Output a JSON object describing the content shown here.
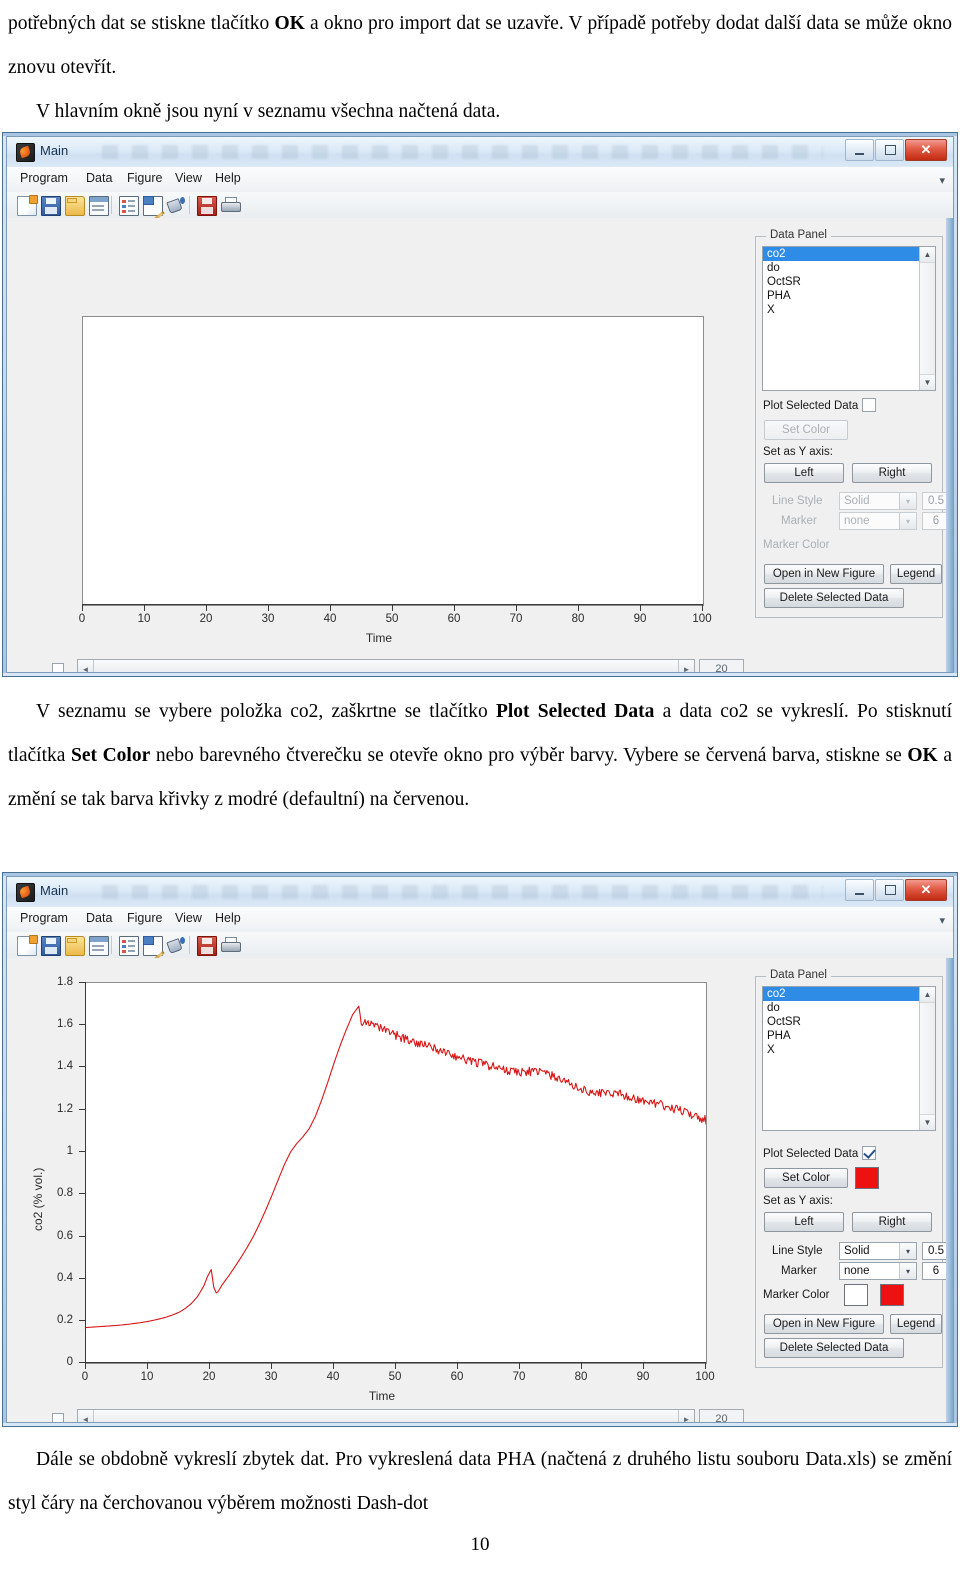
{
  "document": {
    "paragraph_top": [
      "potřebných dat se stiskne tlačítko <b>OK</b> a okno pro import dat se uzavře. V případě potřeby dodat další data se může okno znovu otevřít.",
      "V hlavním okně jsou nyní v seznamu všechna načtená data."
    ],
    "paragraph_mid": "V seznamu se vybere položka co2, zaškrtne se tlačítko <b>Plot Selected Data</b> a data co2 se vykreslí. Po stisknutí tlačítka <b>Set Color</b> nebo barevného čtverečku se otevře okno pro výběr barvy. Vybere se červená barva, stiskne se <b>OK</b> a změní se tak barva křivky z modré (defaultní) na červenou.",
    "paragraph_bottom": "Dále se obdobně vykreslí zbytek dat. Pro vykreslená data PHA (načtená z druhého listu souboru Data.xls) se změní styl čáry na čerchovanou výběrem možnosti Dash-dot",
    "page_number": "10"
  },
  "window1": {
    "title": "Main",
    "icon": "matlab-icon",
    "window_buttons": {
      "minimize": "minimize-icon",
      "maximize": "maximize-icon",
      "close": "✕"
    },
    "menus": [
      "Program",
      "Data",
      "Figure",
      "View",
      "Help"
    ],
    "menu_overflow": "▾",
    "toolbar_icons": [
      "new-file-icon",
      "save-icon",
      "open-folder-icon",
      "window-icon",
      "table-icon",
      "edit-icon",
      "paint-bucket-icon",
      "save-figure-icon",
      "print-icon"
    ],
    "data_panel": {
      "title": "Data Panel",
      "items": [
        "co2",
        "do",
        "OctSR",
        "PHA",
        "X"
      ],
      "selected": "co2",
      "scroll_up": "▲",
      "scroll_down": "▼"
    },
    "controls": {
      "plot_selected_data_label": "Plot Selected Data",
      "plot_selected_data_checked": false,
      "set_color_label": "Set Color",
      "set_color_enabled": false,
      "set_color_swatch": null,
      "set_y_axis_label": "Set as Y axis:",
      "left_label": "Left",
      "right_label": "Right",
      "line_style_label": "Line Style",
      "line_style_value": "Solid",
      "line_width_value": "0.5",
      "marker_label": "Marker",
      "marker_value": "none",
      "marker_size_value": "6",
      "marker_color_label": "Marker Color",
      "marker_color_enabled": false,
      "marker_face_swatch": null,
      "marker_edge_swatch": null,
      "open_in_new_figure_label": "Open in New Figure",
      "legend_label": "Legend",
      "delete_selected_data_label": "Delete Selected Data",
      "fields_enabled": false,
      "dropdown_arrow": "▾"
    },
    "status": {
      "checkbox_checked": false,
      "scroll_left_arrow": "◄",
      "scroll_right_arrow": "►",
      "value": "20"
    }
  },
  "window2": {
    "title": "Main",
    "icon": "matlab-icon",
    "window_buttons": {
      "minimize": "minimize-icon",
      "maximize": "maximize-icon",
      "close": "✕"
    },
    "menus": [
      "Program",
      "Data",
      "Figure",
      "View",
      "Help"
    ],
    "menu_overflow": "▾",
    "toolbar_icons": [
      "new-file-icon",
      "save-icon",
      "open-folder-icon",
      "window-icon",
      "table-icon",
      "edit-icon",
      "paint-bucket-icon",
      "save-figure-icon",
      "print-icon"
    ],
    "data_panel": {
      "title": "Data Panel",
      "items": [
        "co2",
        "do",
        "OctSR",
        "PHA",
        "X"
      ],
      "selected": "co2",
      "scroll_up": "▲",
      "scroll_down": "▼"
    },
    "controls": {
      "plot_selected_data_label": "Plot Selected Data",
      "plot_selected_data_checked": true,
      "set_color_label": "Set Color",
      "set_color_enabled": true,
      "set_color_swatch": "#ee1111",
      "set_y_axis_label": "Set as Y axis:",
      "left_label": "Left",
      "right_label": "Right",
      "line_style_label": "Line Style",
      "line_style_value": "Solid",
      "line_width_value": "0.5",
      "marker_label": "Marker",
      "marker_value": "none",
      "marker_size_value": "6",
      "marker_color_label": "Marker Color",
      "marker_color_enabled": true,
      "marker_face_swatch": "#ffffff",
      "marker_edge_swatch": "#ee1111",
      "open_in_new_figure_label": "Open in New Figure",
      "legend_label": "Legend",
      "delete_selected_data_label": "Delete Selected Data",
      "fields_enabled": true,
      "dropdown_arrow": "▾"
    },
    "status": {
      "checkbox_checked": false,
      "scroll_left_arrow": "◄",
      "scroll_right_arrow": "►",
      "value": "20"
    }
  },
  "chart_data": [
    {
      "type": "line",
      "title": "",
      "xlabel": "Time",
      "ylabel": "",
      "xlim": [
        0,
        100
      ],
      "ylim": [
        0,
        1
      ],
      "xticks": [
        0,
        10,
        20,
        30,
        40,
        50,
        60,
        70,
        80,
        90,
        100
      ],
      "xtick_labels": [
        "0",
        "10",
        "20",
        "30",
        "40",
        "50",
        "60",
        "70",
        "80",
        "90",
        "100"
      ],
      "yticks": [],
      "ytick_labels": [],
      "grid": false,
      "legend": "none",
      "series": [
        {
          "name": "empty",
          "color": "#ffffff",
          "x": [],
          "y": []
        }
      ]
    },
    {
      "type": "line",
      "title": "",
      "xlabel": "Time",
      "ylabel": "co2 (% vol.)",
      "xlim": [
        0,
        100
      ],
      "ylim": [
        0,
        1.8
      ],
      "xticks": [
        0,
        10,
        20,
        30,
        40,
        50,
        60,
        70,
        80,
        90,
        100
      ],
      "xtick_labels": [
        "0",
        "10",
        "20",
        "30",
        "40",
        "50",
        "60",
        "70",
        "80",
        "90",
        "100"
      ],
      "yticks": [
        0,
        0.2,
        0.4,
        0.6,
        0.8,
        1,
        1.2,
        1.4,
        1.6,
        1.8
      ],
      "ytick_labels": [
        "0",
        "0.2",
        "0.4",
        "0.6",
        "0.8",
        "1",
        "1.2",
        "1.4",
        "1.6",
        "1.8"
      ],
      "grid": false,
      "legend": "none",
      "series": [
        {
          "name": "co2",
          "color": "#d81515",
          "line_style": "Solid",
          "line_width": 0.5,
          "marker": "none",
          "x": [
            0,
            1,
            2,
            3,
            4,
            5,
            6,
            7,
            8,
            9,
            10,
            11,
            12,
            13,
            14,
            15,
            16,
            17,
            18,
            19,
            19.6,
            20.2,
            20.6,
            21,
            21.3,
            22,
            23,
            24,
            25,
            26,
            27,
            28,
            29,
            30,
            31,
            32,
            33,
            34,
            35,
            36,
            37,
            38,
            39,
            40,
            41,
            42,
            43,
            44,
            44.4,
            45,
            46,
            47,
            48,
            49,
            50,
            52,
            54,
            56,
            58,
            60,
            62,
            64,
            66,
            68,
            70,
            72,
            74,
            76,
            78,
            80,
            82,
            84,
            86,
            88,
            90,
            92,
            94,
            96,
            98,
            100
          ],
          "y": [
            0.168,
            0.17,
            0.172,
            0.174,
            0.176,
            0.178,
            0.181,
            0.184,
            0.188,
            0.192,
            0.197,
            0.203,
            0.21,
            0.218,
            0.228,
            0.24,
            0.258,
            0.282,
            0.315,
            0.365,
            0.41,
            0.443,
            0.36,
            0.332,
            0.338,
            0.372,
            0.412,
            0.455,
            0.5,
            0.548,
            0.6,
            0.66,
            0.725,
            0.795,
            0.868,
            0.94,
            1.0,
            1.04,
            1.072,
            1.11,
            1.168,
            1.245,
            1.33,
            1.42,
            1.505,
            1.58,
            1.65,
            1.69,
            1.615,
            1.625,
            1.6,
            1.588,
            1.578,
            1.565,
            1.552,
            1.53,
            1.51,
            1.492,
            1.47,
            1.448,
            1.432,
            1.418,
            1.4,
            1.386,
            1.378,
            1.382,
            1.374,
            1.35,
            1.322,
            1.296,
            1.278,
            1.282,
            1.276,
            1.258,
            1.24,
            1.228,
            1.212,
            1.196,
            1.175,
            1.15,
            1.13
          ]
        }
      ]
    }
  ]
}
